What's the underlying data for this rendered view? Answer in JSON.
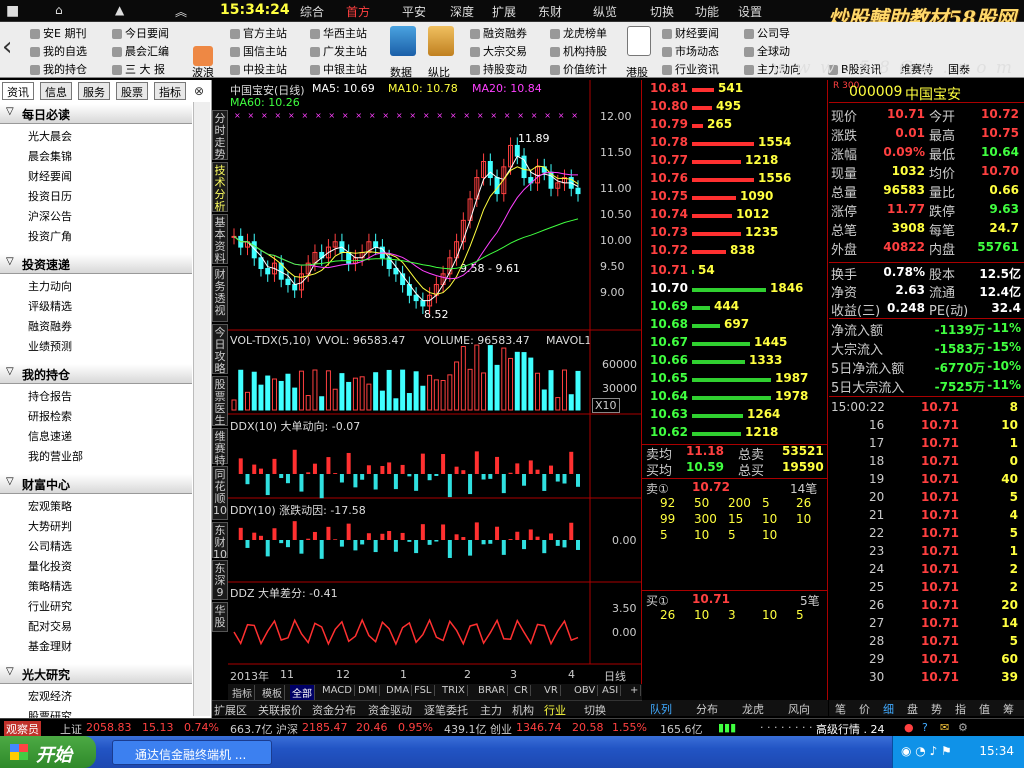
{
  "menu": {
    "items": [
      "综合",
      "首方",
      "平安",
      "深度",
      "扩展",
      "东财",
      "纵览",
      "切换",
      "功能",
      "设置"
    ],
    "active_index": 1,
    "clock": "15:34:24",
    "watermark": "炒股輔助教材58股网",
    "watermark_url": "w w w . 5 8 G u . c o m"
  },
  "toolbar": {
    "group1": [
      "安E 期刊",
      "我的自选",
      "我的持仓"
    ],
    "group2": [
      "今日要闻",
      "晨会汇编",
      "三 大 报"
    ],
    "group3_label": "波浪",
    "group4": [
      "官方主站",
      "国信主站",
      "中投主站"
    ],
    "group5": [
      "华西主站",
      "广发主站",
      "中银主站"
    ],
    "group6_labels": [
      "数据",
      "纵比"
    ],
    "group7": [
      "融资融券",
      "大宗交易",
      "持股变动"
    ],
    "group8": [
      "龙虎榜单",
      "机构持股",
      "价值统计"
    ],
    "group9_label": "港股",
    "group10": [
      "财经要闻",
      "市场动态",
      "行业资讯"
    ],
    "group11": [
      "公司导",
      "全球动",
      "主力动向"
    ],
    "group12": [
      "B股资讯",
      "维赛特",
      "国泰"
    ]
  },
  "left_panel": {
    "tabs": [
      "资讯",
      "信息",
      "服务",
      "股票",
      "指标"
    ],
    "sections": [
      {
        "title": "每日必读",
        "items": [
          "光大晨会",
          "晨会集锦",
          "财经要闻",
          "投资日历",
          "沪深公告",
          "投资广角"
        ]
      },
      {
        "title": "投资速递",
        "items": [
          "主力动向",
          "评级精选",
          "融资融券",
          "业绩预测"
        ]
      },
      {
        "title": "我的持仓",
        "items": [
          "持仓报告",
          "研报检索",
          "信息速递",
          "我的营业部"
        ]
      },
      {
        "title": "财富中心",
        "items": [
          "宏观策略",
          "大势研判",
          "公司精选",
          "量化投资",
          "策略精选",
          "行业研究",
          "配对交易",
          "基金理财"
        ]
      },
      {
        "title": "光大研究",
        "items": [
          "宏观经济",
          "股票研究"
        ]
      }
    ]
  },
  "vertical_tabs": [
    "分时走势",
    "技术分析",
    "基本资料",
    "财务透视",
    "今日攻略",
    "股票医生",
    "维赛特",
    "同花顺10",
    "东财10",
    "东深9",
    "华股"
  ],
  "chart": {
    "title": "中国宝安(日线)",
    "ma5": "MA5: 10.69",
    "ma10": "MA10: 10.78",
    "ma20": "MA20: 10.84",
    "ma60": "MA60: 10.26",
    "high_label": "11.89",
    "low_label": "8.52",
    "mid_label": "9.58 - 9.61",
    "price_ticks": [
      "12.00",
      "11.50",
      "11.00",
      "10.50",
      "10.00",
      "9.50",
      "9.00"
    ],
    "vol_title": "VOL-TDX(5,10)",
    "vvol": "VVOL: 96583.47",
    "volume": "VOLUME: 96583.47",
    "mavol": "MAVOL1",
    "vol_ticks": [
      "60000",
      "30000"
    ],
    "vol_unit": "X10",
    "ddx_title": "DDX(10) 大单动向: -0.07",
    "ddy_title": "DDY(10) 涨跌动因: -17.58",
    "ddy_tick": "0.00",
    "ddz_title": "DDZ 大单差分: -0.41",
    "ddz_ticks": [
      "3.50",
      "0.00"
    ],
    "date_labels": [
      "2013年",
      "11",
      "12",
      "1",
      "2",
      "3",
      "4"
    ],
    "period": "日线",
    "bottom_tabs": [
      "指标",
      "模板",
      "全部",
      "MACD",
      "DMI",
      "DMA",
      "FSL",
      "TRIX",
      "BRAR",
      "CR",
      "VR",
      "OBV",
      "ASI",
      "+",
      "-",
      "↓"
    ]
  },
  "sub_tabs": [
    "扩展区",
    "关联报价",
    "资金分布",
    "资金驱动",
    "逐笔委托",
    "主力",
    "机构",
    "行业",
    "切换"
  ],
  "orderbook": {
    "asks": [
      {
        "p": "10.81",
        "v": "541"
      },
      {
        "p": "10.80",
        "v": "495"
      },
      {
        "p": "10.79",
        "v": "265"
      },
      {
        "p": "10.78",
        "v": "1554"
      },
      {
        "p": "10.77",
        "v": "1218"
      },
      {
        "p": "10.76",
        "v": "1556"
      },
      {
        "p": "10.75",
        "v": "1090"
      },
      {
        "p": "10.74",
        "v": "1012"
      },
      {
        "p": "10.73",
        "v": "1235"
      },
      {
        "p": "10.72",
        "v": "838"
      }
    ],
    "bids": [
      {
        "p": "10.71",
        "v": "54"
      },
      {
        "p": "10.70",
        "v": "1846"
      },
      {
        "p": "10.69",
        "v": "444"
      },
      {
        "p": "10.68",
        "v": "697"
      },
      {
        "p": "10.67",
        "v": "1445"
      },
      {
        "p": "10.66",
        "v": "1333"
      },
      {
        "p": "10.65",
        "v": "1987"
      },
      {
        "p": "10.64",
        "v": "1978"
      },
      {
        "p": "10.63",
        "v": "1264"
      },
      {
        "p": "10.62",
        "v": "1218"
      }
    ],
    "sell_avg_label": "卖均",
    "sell_avg": "11.18",
    "sell_total_label": "总卖",
    "sell_total": "53521",
    "buy_avg_label": "买均",
    "buy_avg": "10.59",
    "buy_total_label": "总买",
    "buy_total": "19590",
    "sell1_label": "卖①",
    "sell1_price": "10.72",
    "sell1_count": "14笔",
    "sell1_queue": [
      [
        "92",
        "50",
        "200",
        "5",
        "26"
      ],
      [
        "99",
        "300",
        "15",
        "10",
        "10"
      ],
      [
        "5",
        "10",
        "5",
        "10",
        ""
      ]
    ],
    "buy1_label": "买①",
    "buy1_price": "10.71",
    "buy1_count": "5笔",
    "buy1_queue": [
      [
        "26",
        "10",
        "3",
        "10",
        "5"
      ]
    ],
    "tabs": [
      "队列",
      "分布",
      "龙虎",
      "风向"
    ]
  },
  "quote": {
    "code": "000009",
    "name": "中国宝安",
    "badge": "R 300",
    "rows": [
      [
        "现价",
        "10.71",
        "今开",
        "10.72"
      ],
      [
        "涨跌",
        "0.01",
        "最高",
        "10.75"
      ],
      [
        "涨幅",
        "0.09%",
        "最低",
        "10.64"
      ],
      [
        "现量",
        "1032",
        "均价",
        "10.70"
      ],
      [
        "总量",
        "96583",
        "量比",
        "0.66"
      ],
      [
        "涨停",
        "11.77",
        "跌停",
        "9.63"
      ],
      [
        "总笔",
        "3908",
        "每笔",
        "24.7"
      ],
      [
        "外盘",
        "40822",
        "内盘",
        "55761"
      ]
    ],
    "rows2": [
      [
        "换手",
        "0.78%",
        "股本",
        "12.5亿"
      ],
      [
        "净资",
        "2.63",
        "流通",
        "12.4亿"
      ],
      [
        "收益(三)",
        "0.248",
        "PE(动)",
        "32.4"
      ]
    ],
    "flows": [
      [
        "净流入额",
        "-1139万",
        "-11%"
      ],
      [
        "大宗流入",
        "-1583万",
        "-15%"
      ],
      [
        "5日净流入额",
        "-6770万",
        "-10%"
      ],
      [
        "5日大宗流入",
        "-7525万",
        "-11%"
      ]
    ],
    "ticks": [
      [
        "15:00:22",
        "10.71",
        "8"
      ],
      [
        "16",
        "10.71",
        "10"
      ],
      [
        "17",
        "10.71",
        "1"
      ],
      [
        "18",
        "10.71",
        "0"
      ],
      [
        "19",
        "10.71",
        "40"
      ],
      [
        "20",
        "10.71",
        "5"
      ],
      [
        "21",
        "10.71",
        "4"
      ],
      [
        "22",
        "10.71",
        "5"
      ],
      [
        "23",
        "10.71",
        "1"
      ],
      [
        "24",
        "10.71",
        "2"
      ],
      [
        "25",
        "10.71",
        "2"
      ],
      [
        "26",
        "10.71",
        "20"
      ],
      [
        "27",
        "10.71",
        "14"
      ],
      [
        "28",
        "10.71",
        "5"
      ],
      [
        "29",
        "10.71",
        "60"
      ],
      [
        "30",
        "10.71",
        "39"
      ]
    ],
    "tabs": [
      "笔",
      "价",
      "细",
      "盘",
      "势",
      "指",
      "值",
      "筹"
    ]
  },
  "statusbar": {
    "brand": "观察员",
    "sh_label": "上证",
    "sh": "2058.83",
    "sh_chg": "15.13",
    "sh_pct": "0.74%",
    "sh_amt": "663.7亿",
    "sz_label": "沪深",
    "sz": "2185.47",
    "sz_chg": "20.46",
    "sz_pct": "0.95%",
    "sz_amt": "439.1亿",
    "cy_label": "创业",
    "cy": "1346.74",
    "cy_chg": "20.58",
    "cy_pct": "1.55%",
    "cy_amt": "165.6亿",
    "market_label": "高级行情 . 24"
  },
  "taskbar": {
    "start": "开始",
    "item": "通达信金融终端机 ...",
    "clock": "15:34"
  },
  "chart_data": {
    "type": "candlestick",
    "title": "中国宝安(日线)",
    "ylim": [
      8.3,
      12.3
    ],
    "annotations": {
      "high": 11.89,
      "low": 8.52
    },
    "series_close": [
      9.9,
      9.7,
      9.8,
      9.5,
      9.3,
      9.2,
      9.4,
      9.1,
      9.0,
      8.9,
      9.2,
      9.4,
      9.6,
      9.5,
      9.7,
      9.8,
      9.6,
      9.4,
      9.5,
      9.6,
      9.8,
      9.7,
      9.5,
      9.3,
      9.2,
      9.0,
      8.8,
      8.7,
      8.6,
      8.8,
      9.0,
      9.2,
      9.5,
      9.8,
      10.2,
      10.6,
      11.0,
      11.3,
      11.0,
      10.7,
      11.2,
      11.6,
      11.4,
      11.0,
      10.9,
      11.2,
      11.1,
      10.8,
      10.9,
      11.0,
      10.8,
      10.7
    ],
    "ma_colors": {
      "ma5": "#ffffff",
      "ma10": "#ffff40",
      "ma20": "#ff40ff",
      "ma60": "#40ff40"
    }
  }
}
